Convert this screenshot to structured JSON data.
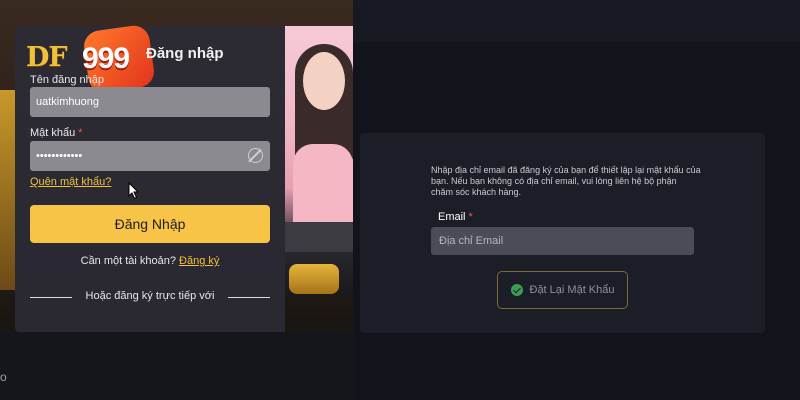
{
  "brand": {
    "logo_df": "DF",
    "logo_999": "999"
  },
  "login": {
    "title": "Đăng nhập",
    "username_label": "Tên đăng nhập",
    "username_value": "uatkimhuong",
    "password_label": "Mật khẩu",
    "password_value": "••••••••••••",
    "required_mark": "*",
    "forgot_link": "Quên mật khẩu?",
    "submit_label": "Đăng Nhập",
    "signup_prompt": "Cần một tài khoản?",
    "signup_link": "Đăng ký",
    "social_divider": "Hoặc đăng ký trực tiếp với"
  },
  "reset": {
    "description": "Nhập địa chỉ email đã đăng ký của bạn để thiết lập lại mật khẩu của bạn. Nếu bạn không có địa chỉ email, vui lòng liên hệ bộ phận chăm sóc khách hàng.",
    "email_label": "Email",
    "required_mark": "*",
    "email_placeholder": "Địa chỉ Email",
    "submit_label": "Đặt Lại Mật Khẩu"
  },
  "page": {
    "corner_text": "o"
  },
  "colors": {
    "accent": "#f8c447",
    "link": "#f2c13d",
    "required": "#ff4d4f",
    "check": "#3f9a55"
  },
  "icons": {
    "password_toggle": "eye-off-icon",
    "reset_button": "check-circle-icon",
    "cursor": "mouse-pointer-icon"
  }
}
